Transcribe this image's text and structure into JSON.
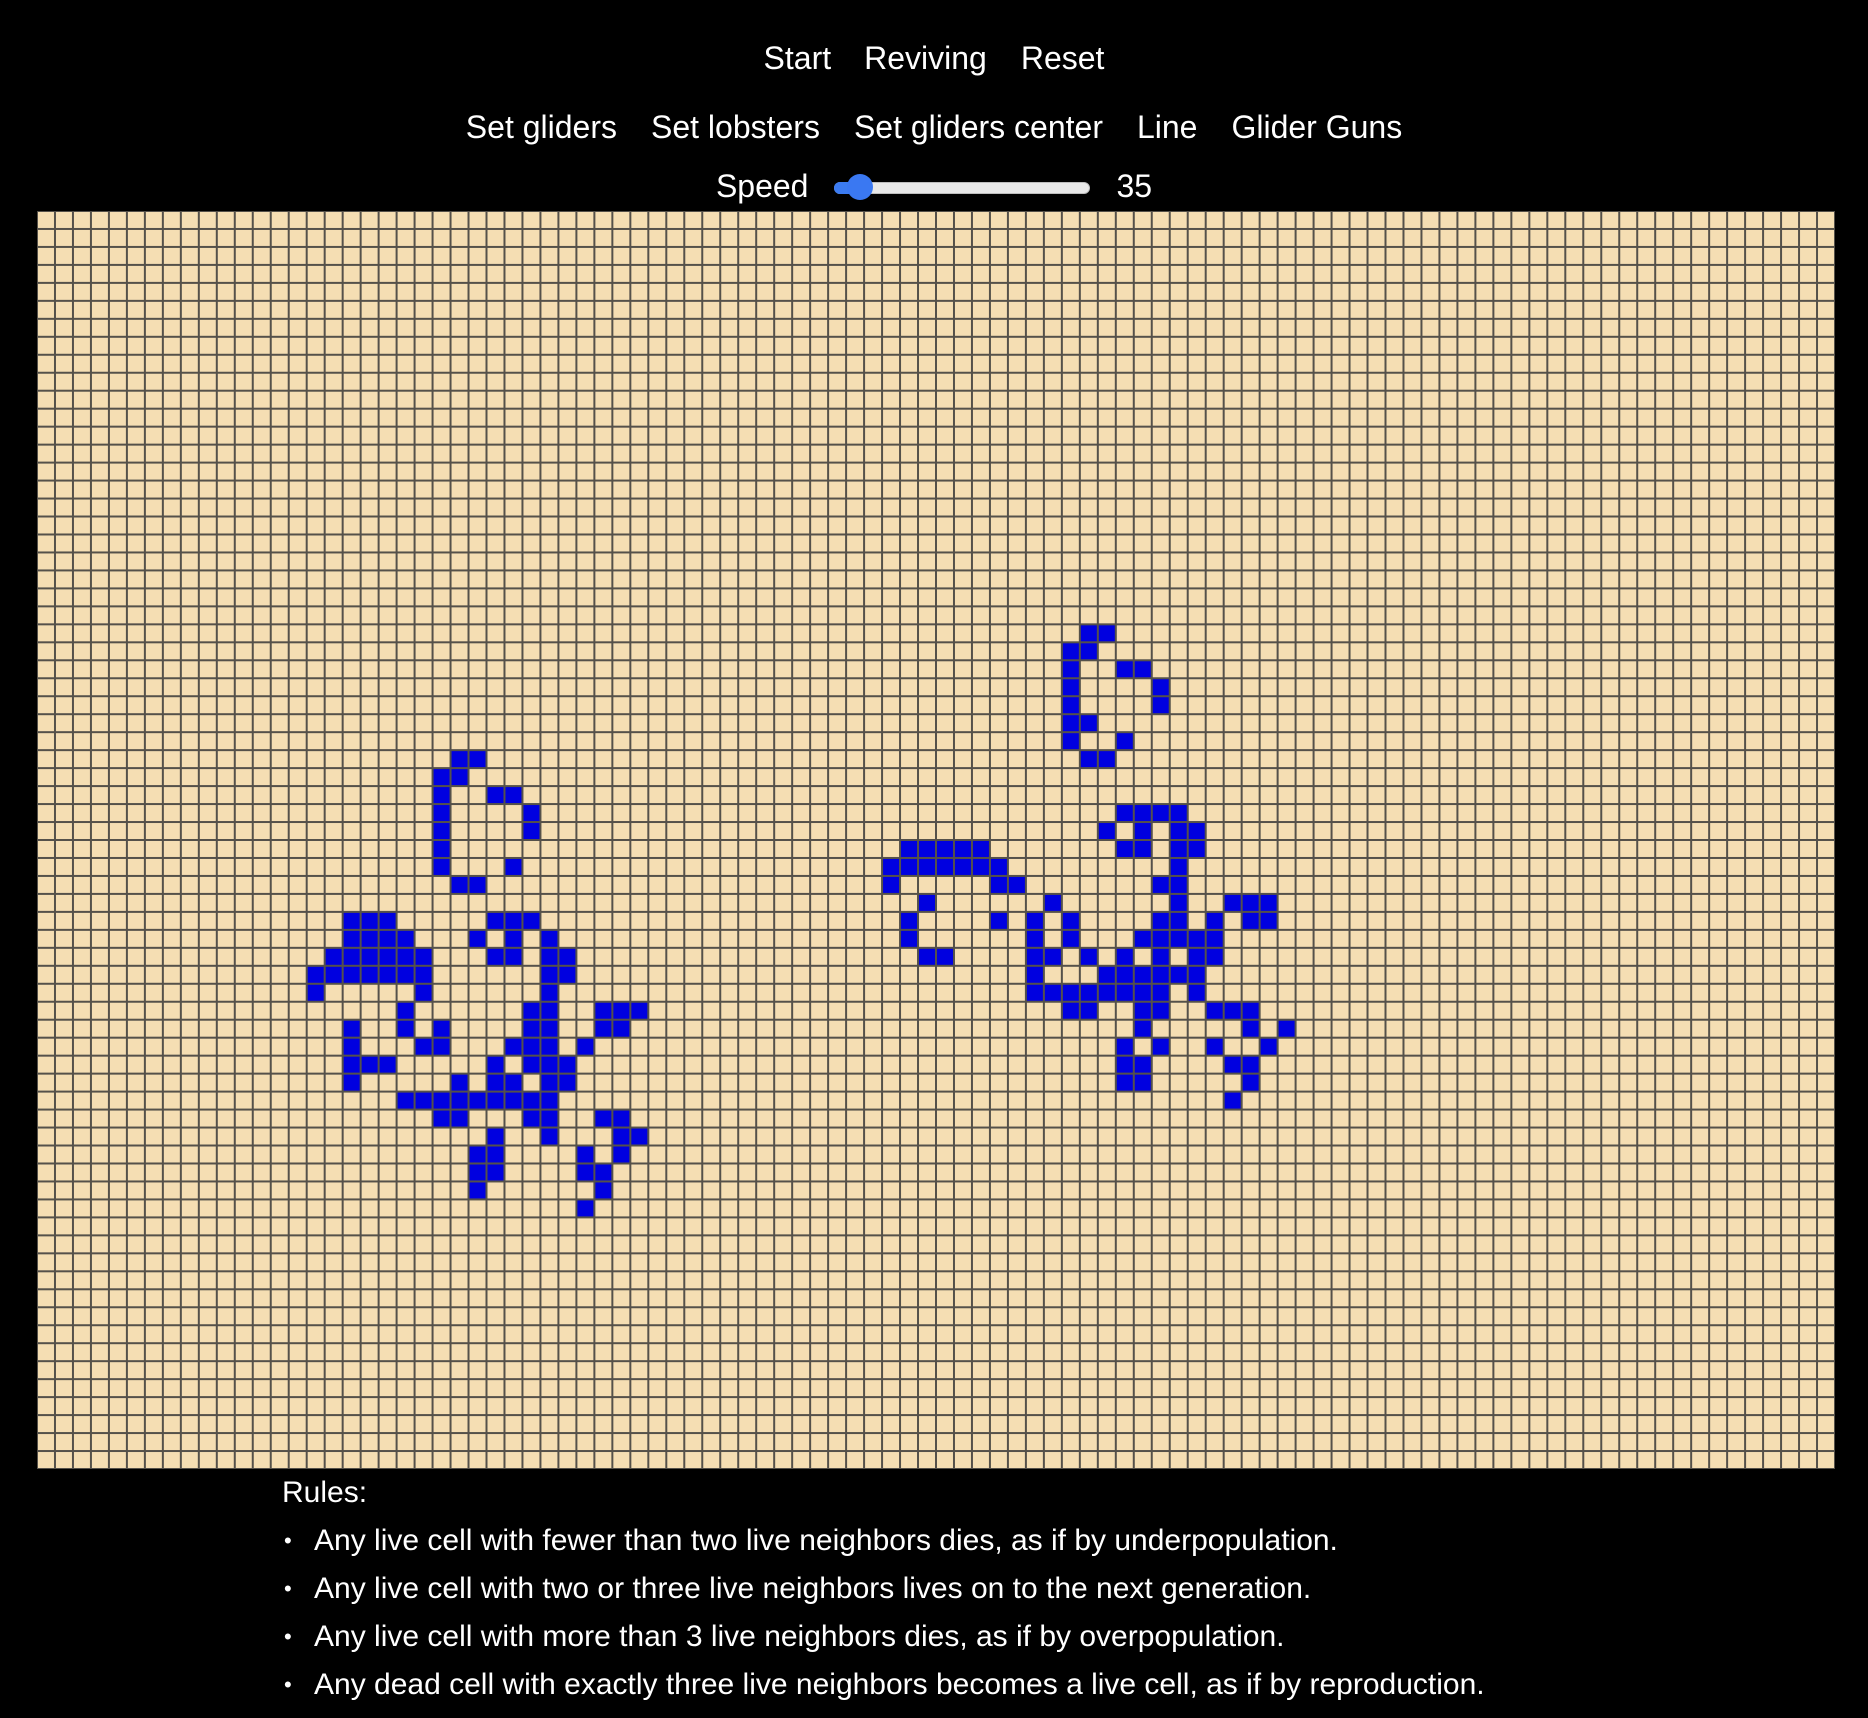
{
  "controls": {
    "start_label": "Start",
    "reviving_label": "Reviving",
    "reset_label": "Reset"
  },
  "presets": {
    "set_gliders_label": "Set gliders",
    "set_lobsters_label": "Set lobsters",
    "set_gliders_center_label": "Set gliders center",
    "line_label": "Line",
    "glider_guns_label": "Glider Guns"
  },
  "speed": {
    "label": "Speed",
    "value": "35",
    "min": 0,
    "max": 100,
    "fraction": 0.1
  },
  "board": {
    "cols": 100,
    "rows": 70,
    "colors": {
      "dead": "#f5deb3",
      "alive": "#0000e0",
      "grid_line": "#55514a"
    },
    "live_cells": [
      [
        23,
        30
      ],
      [
        24,
        30
      ],
      [
        22,
        31
      ],
      [
        23,
        31
      ],
      [
        22,
        32
      ],
      [
        25,
        32
      ],
      [
        26,
        32
      ],
      [
        22,
        33
      ],
      [
        27,
        33
      ],
      [
        22,
        34
      ],
      [
        27,
        34
      ],
      [
        22,
        35
      ],
      [
        22,
        36
      ],
      [
        26,
        36
      ],
      [
        23,
        37
      ],
      [
        24,
        37
      ],
      [
        17,
        39
      ],
      [
        18,
        39
      ],
      [
        19,
        39
      ],
      [
        25,
        39
      ],
      [
        26,
        39
      ],
      [
        27,
        39
      ],
      [
        17,
        40
      ],
      [
        18,
        40
      ],
      [
        19,
        40
      ],
      [
        20,
        40
      ],
      [
        24,
        40
      ],
      [
        26,
        40
      ],
      [
        28,
        40
      ],
      [
        16,
        41
      ],
      [
        17,
        41
      ],
      [
        18,
        41
      ],
      [
        19,
        41
      ],
      [
        20,
        41
      ],
      [
        21,
        41
      ],
      [
        25,
        41
      ],
      [
        26,
        41
      ],
      [
        28,
        41
      ],
      [
        29,
        41
      ],
      [
        15,
        42
      ],
      [
        16,
        42
      ],
      [
        17,
        42
      ],
      [
        18,
        42
      ],
      [
        19,
        42
      ],
      [
        20,
        42
      ],
      [
        21,
        42
      ],
      [
        28,
        42
      ],
      [
        29,
        42
      ],
      [
        15,
        43
      ],
      [
        21,
        43
      ],
      [
        28,
        43
      ],
      [
        20,
        44
      ],
      [
        27,
        44
      ],
      [
        28,
        44
      ],
      [
        31,
        44
      ],
      [
        32,
        44
      ],
      [
        33,
        44
      ],
      [
        17,
        45
      ],
      [
        20,
        45
      ],
      [
        22,
        45
      ],
      [
        22,
        46
      ],
      [
        21,
        46
      ],
      [
        27,
        45
      ],
      [
        28,
        45
      ],
      [
        31,
        45
      ],
      [
        32,
        45
      ],
      [
        17,
        46
      ],
      [
        26,
        46
      ],
      [
        27,
        46
      ],
      [
        28,
        46
      ],
      [
        30,
        46
      ],
      [
        17,
        47
      ],
      [
        18,
        47
      ],
      [
        19,
        47
      ],
      [
        25,
        47
      ],
      [
        27,
        47
      ],
      [
        28,
        47
      ],
      [
        29,
        47
      ],
      [
        17,
        48
      ],
      [
        23,
        48
      ],
      [
        25,
        48
      ],
      [
        26,
        48
      ],
      [
        28,
        48
      ],
      [
        29,
        48
      ],
      [
        20,
        49
      ],
      [
        21,
        49
      ],
      [
        22,
        49
      ],
      [
        23,
        49
      ],
      [
        24,
        49
      ],
      [
        25,
        49
      ],
      [
        26,
        49
      ],
      [
        27,
        49
      ],
      [
        28,
        49
      ],
      [
        22,
        50
      ],
      [
        23,
        50
      ],
      [
        27,
        50
      ],
      [
        28,
        50
      ],
      [
        31,
        50
      ],
      [
        32,
        50
      ],
      [
        25,
        51
      ],
      [
        28,
        51
      ],
      [
        32,
        51
      ],
      [
        33,
        51
      ],
      [
        24,
        52
      ],
      [
        25,
        52
      ],
      [
        30,
        52
      ],
      [
        32,
        52
      ],
      [
        24,
        53
      ],
      [
        25,
        53
      ],
      [
        30,
        53
      ],
      [
        31,
        53
      ],
      [
        24,
        54
      ],
      [
        31,
        54
      ],
      [
        30,
        55
      ],
      [
        18,
        42
      ],
      [
        58,
        23
      ],
      [
        59,
        23
      ],
      [
        57,
        24
      ],
      [
        58,
        24
      ],
      [
        57,
        25
      ],
      [
        60,
        25
      ],
      [
        61,
        25
      ],
      [
        57,
        26
      ],
      [
        62,
        26
      ],
      [
        57,
        27
      ],
      [
        62,
        27
      ],
      [
        57,
        28
      ],
      [
        58,
        28
      ],
      [
        57,
        29
      ],
      [
        60,
        29
      ],
      [
        58,
        30
      ],
      [
        59,
        30
      ],
      [
        60,
        33
      ],
      [
        61,
        33
      ],
      [
        62,
        33
      ],
      [
        63,
        33
      ],
      [
        59,
        34
      ],
      [
        61,
        34
      ],
      [
        63,
        34
      ],
      [
        64,
        34
      ],
      [
        48,
        35
      ],
      [
        49,
        35
      ],
      [
        50,
        35
      ],
      [
        51,
        35
      ],
      [
        52,
        35
      ],
      [
        60,
        35
      ],
      [
        61,
        35
      ],
      [
        63,
        35
      ],
      [
        64,
        35
      ],
      [
        47,
        36
      ],
      [
        48,
        36
      ],
      [
        49,
        36
      ],
      [
        50,
        36
      ],
      [
        51,
        36
      ],
      [
        52,
        36
      ],
      [
        53,
        36
      ],
      [
        63,
        36
      ],
      [
        47,
        37
      ],
      [
        53,
        37
      ],
      [
        54,
        37
      ],
      [
        62,
        37
      ],
      [
        63,
        37
      ],
      [
        49,
        38
      ],
      [
        56,
        38
      ],
      [
        63,
        38
      ],
      [
        66,
        38
      ],
      [
        67,
        38
      ],
      [
        68,
        38
      ],
      [
        48,
        39
      ],
      [
        53,
        39
      ],
      [
        55,
        39
      ],
      [
        57,
        39
      ],
      [
        62,
        39
      ],
      [
        63,
        39
      ],
      [
        65,
        39
      ],
      [
        67,
        39
      ],
      [
        68,
        39
      ],
      [
        48,
        40
      ],
      [
        55,
        40
      ],
      [
        57,
        40
      ],
      [
        61,
        40
      ],
      [
        62,
        40
      ],
      [
        63,
        40
      ],
      [
        64,
        40
      ],
      [
        65,
        40
      ],
      [
        49,
        41
      ],
      [
        50,
        41
      ],
      [
        55,
        41
      ],
      [
        56,
        41
      ],
      [
        58,
        41
      ],
      [
        60,
        41
      ],
      [
        62,
        41
      ],
      [
        64,
        41
      ],
      [
        65,
        41
      ],
      [
        55,
        42
      ],
      [
        59,
        42
      ],
      [
        60,
        42
      ],
      [
        61,
        42
      ],
      [
        62,
        42
      ],
      [
        63,
        42
      ],
      [
        64,
        42
      ],
      [
        55,
        43
      ],
      [
        56,
        43
      ],
      [
        57,
        43
      ],
      [
        58,
        43
      ],
      [
        59,
        43
      ],
      [
        60,
        43
      ],
      [
        61,
        43
      ],
      [
        62,
        43
      ],
      [
        64,
        43
      ],
      [
        57,
        44
      ],
      [
        58,
        44
      ],
      [
        61,
        44
      ],
      [
        62,
        44
      ],
      [
        65,
        44
      ],
      [
        66,
        44
      ],
      [
        67,
        44
      ],
      [
        61,
        45
      ],
      [
        67,
        45
      ],
      [
        69,
        45
      ],
      [
        60,
        46
      ],
      [
        62,
        46
      ],
      [
        65,
        46
      ],
      [
        68,
        46
      ],
      [
        60,
        47
      ],
      [
        61,
        47
      ],
      [
        66,
        47
      ],
      [
        67,
        47
      ],
      [
        60,
        48
      ],
      [
        61,
        48
      ],
      [
        67,
        48
      ],
      [
        66,
        49
      ]
    ]
  },
  "rules": {
    "title": "Rules:",
    "items": [
      "Any live cell with fewer than two live neighbors dies, as if by underpopulation.",
      "Any live cell with two or three live neighbors lives on to the next generation.",
      "Any live cell with more than 3 live neighbors dies, as if by overpopulation.",
      "Any dead cell with exactly three live neighbors becomes a live cell, as if by reproduction."
    ]
  }
}
